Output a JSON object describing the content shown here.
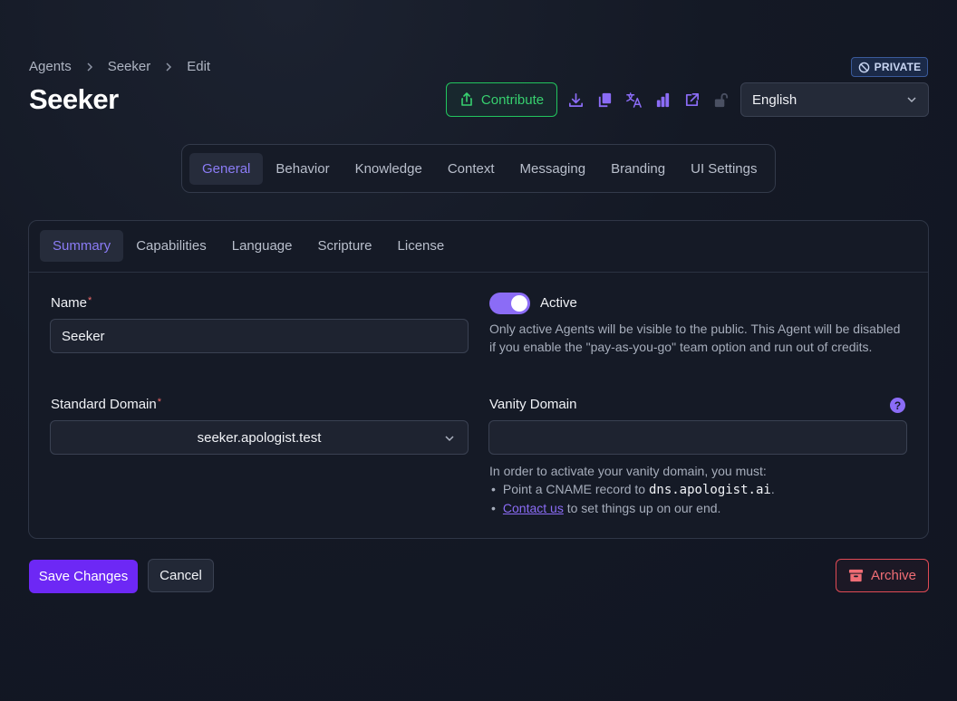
{
  "breadcrumb": {
    "items": [
      "Agents",
      "Seeker",
      "Edit"
    ]
  },
  "badge": {
    "private_label": "PRIVATE"
  },
  "page": {
    "title": "Seeker"
  },
  "header": {
    "contribute_label": "Contribute",
    "toolbar_icons": [
      "download-icon",
      "copy-icon",
      "translate-icon",
      "bar-chart-icon",
      "external-link-icon",
      "unlock-icon"
    ],
    "language": "English"
  },
  "main_tabs": [
    "General",
    "Behavior",
    "Knowledge",
    "Context",
    "Messaging",
    "Branding",
    "UI Settings"
  ],
  "main_tabs_active": "General",
  "sub_tabs": [
    "Summary",
    "Capabilities",
    "Language",
    "Scripture",
    "License"
  ],
  "sub_tabs_active": "Summary",
  "form": {
    "name_label": "Name",
    "name_value": "Seeker",
    "required_mark": "*",
    "active_label": "Active",
    "active_value": true,
    "active_help": "Only active Agents will be visible to the public. This Agent will be disabled if you enable the \"pay-as-you-go\" team option and run out of credits.",
    "standard_domain_label": "Standard Domain",
    "standard_domain_value": "seeker.apologist.test",
    "vanity_domain_label": "Vanity Domain",
    "vanity_domain_value": "",
    "help_icon_label": "?",
    "vanity_help_intro": "In order to activate your vanity domain, you must:",
    "vanity_help_point1_prefix": "Point a CNAME record to ",
    "vanity_help_point1_code": "dns.apologist.ai",
    "vanity_help_point1_suffix": ".",
    "vanity_help_point2_link": "Contact us",
    "vanity_help_point2_suffix": " to set things up on our end.",
    "bullet": "•"
  },
  "actions": {
    "save_label": "Save Changes",
    "cancel_label": "Cancel",
    "archive_label": "Archive"
  },
  "colors": {
    "accent": "#8b6cf6",
    "primary_button": "#6d28f5",
    "contribute_green": "#22c55e",
    "danger": "#e04a55"
  }
}
